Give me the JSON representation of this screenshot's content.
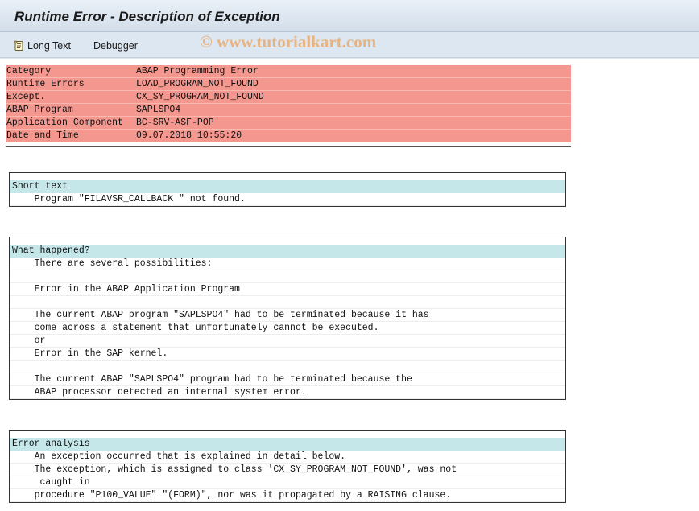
{
  "window": {
    "title": "Runtime Error - Description of Exception"
  },
  "toolbar": {
    "long_text_label": "Long Text",
    "debugger_label": "Debugger"
  },
  "watermark": "© www.tutorialkart.com",
  "header": {
    "rows": [
      {
        "key": "Category",
        "value": "ABAP Programming Error"
      },
      {
        "key": "Runtime Errors",
        "value": "LOAD_PROGRAM_NOT_FOUND"
      },
      {
        "key": "Except.",
        "value": "CX_SY_PROGRAM_NOT_FOUND"
      },
      {
        "key": "ABAP Program",
        "value": "SAPLSPO4"
      },
      {
        "key": "Application Component",
        "value": "BC-SRV-ASF-POP"
      },
      {
        "key": "Date and Time",
        "value": "09.07.2018 10:55:20"
      }
    ]
  },
  "sections": [
    {
      "heading": "Short text",
      "lines": [
        "    Program \"FILAVSR_CALLBACK \" not found."
      ]
    },
    {
      "heading": "What happened?",
      "lines": [
        "    There are several possibilities:",
        "",
        "    Error in the ABAP Application Program",
        "",
        "    The current ABAP program \"SAPLSPO4\" had to be terminated because it has",
        "    come across a statement that unfortunately cannot be executed.",
        "    or",
        "    Error in the SAP kernel.",
        "",
        "    The current ABAP \"SAPLSPO4\" program had to be terminated because the",
        "    ABAP processor detected an internal system error."
      ]
    },
    {
      "heading": "Error analysis",
      "lines": [
        "    An exception occurred that is explained in detail below.",
        "    The exception, which is assigned to class 'CX_SY_PROGRAM_NOT_FOUND', was not",
        "     caught in",
        "    procedure \"P100_VALUE\" \"(FORM)\", nor was it propagated by a RAISING clause."
      ]
    }
  ],
  "colors": {
    "header_row": "#f4978e",
    "section_heading": "#c5e7ea",
    "watermark": "#e8aa6e"
  }
}
